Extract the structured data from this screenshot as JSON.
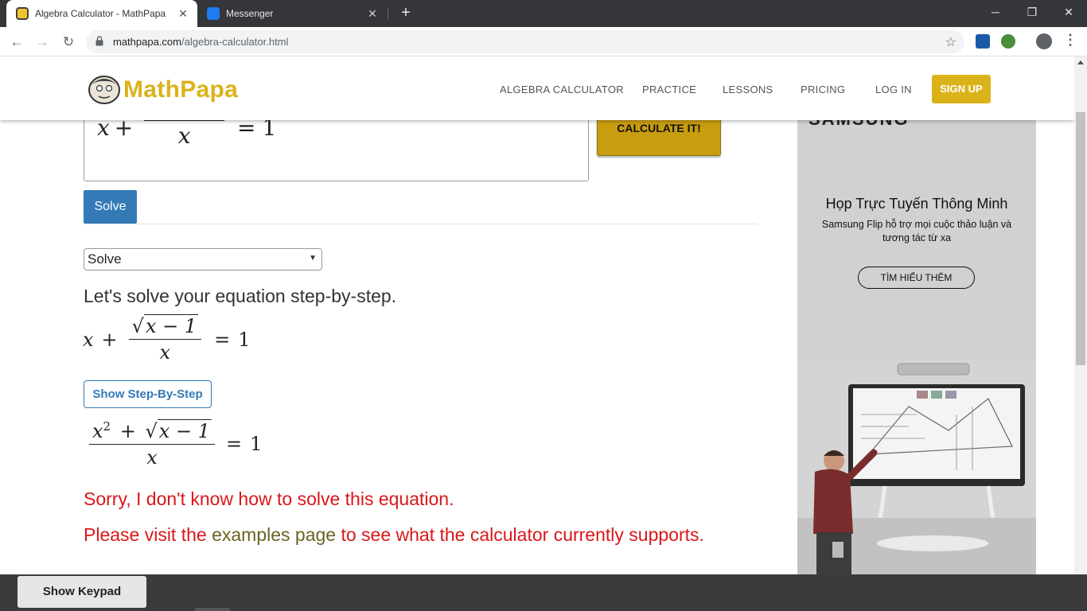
{
  "browser": {
    "tabs": [
      {
        "title": "Algebra Calculator - MathPapa",
        "active": true
      },
      {
        "title": "Messenger",
        "active": false
      }
    ],
    "url_domain": "mathpapa.com",
    "url_path": "/algebra-calculator.html"
  },
  "site": {
    "logo": "MathPapa",
    "nav": [
      "ALGEBRA CALCULATOR",
      "PRACTICE",
      "LESSONS",
      "PRICING",
      "LOG IN"
    ],
    "signup": "SIGN UP"
  },
  "calculator": {
    "calculate_label": "CALCULATE IT!",
    "solve_label": "Solve",
    "mode_selected": "Solve",
    "intro": "Let's solve your equation step-by-step.",
    "show_steps_label": "Show Step-By-Step",
    "error_line1": "Sorry, I don't know how to solve this equation.",
    "error_line2_pre": "Please visit the ",
    "error_line2_link": "examples page",
    "error_line2_post": " to see what the calculator currently supports."
  },
  "math": {
    "x": "x",
    "plus": "+",
    "minus": "−",
    "equals": "=",
    "one": "1",
    "sqrt_symbol": "√",
    "sqrt_arg": "x − 1",
    "exponent": "2"
  },
  "ad": {
    "brand": "SAMSUNG",
    "headline": "Họp Trực Tuyến Thông Minh",
    "subline": "Samsung Flip hỗ trợ mọi cuộc thảo luận và tương tác từ xa",
    "cta": "TÌM HIỂU THÊM"
  },
  "bottom": {
    "keypad_label": "Show Keypad"
  }
}
